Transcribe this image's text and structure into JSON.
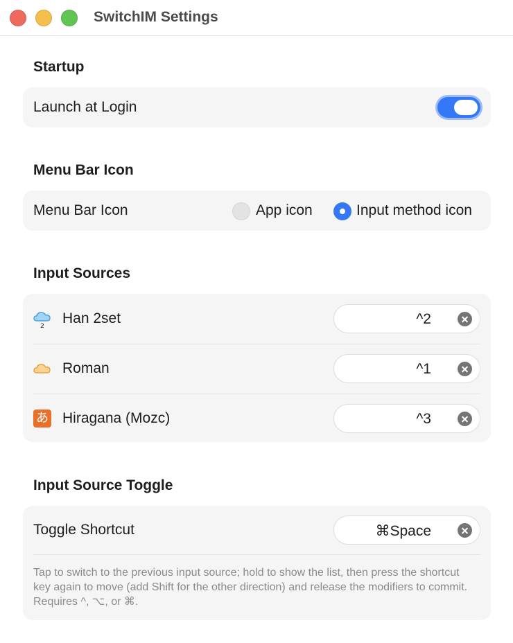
{
  "window": {
    "title": "SwitchIM Settings"
  },
  "startup": {
    "header": "Startup",
    "launch_at_login_label": "Launch at Login",
    "launch_at_login_enabled": true
  },
  "menu_bar": {
    "header": "Menu Bar Icon",
    "row_label": "Menu Bar Icon",
    "options": [
      {
        "label": "App icon",
        "selected": false
      },
      {
        "label": "Input method icon",
        "selected": true
      }
    ]
  },
  "input_sources": {
    "header": "Input Sources",
    "items": [
      {
        "name": "Han 2set",
        "icon": "cloud-blue-2-icon",
        "shortcut": "^2"
      },
      {
        "name": "Roman",
        "icon": "cloud-orange-icon",
        "shortcut": "^1"
      },
      {
        "name": "Hiragana (Mozc)",
        "icon": "hiragana-a-icon",
        "icon_glyph": "あ",
        "shortcut": "^3"
      }
    ]
  },
  "toggle": {
    "header": "Input Source Toggle",
    "shortcut_label": "Toggle Shortcut",
    "shortcut_value": "⌘Space",
    "help_text": "Tap to switch to the previous input source; hold to show the list, then press the shortcut key again to move (add Shift for the other direction) and release the modifiers to commit. Requires ^, ⌥, or ⌘."
  },
  "colors": {
    "accent": "#3478f6",
    "card_background": "#f5f5f5",
    "secondary_text": "#8a8a8e"
  }
}
